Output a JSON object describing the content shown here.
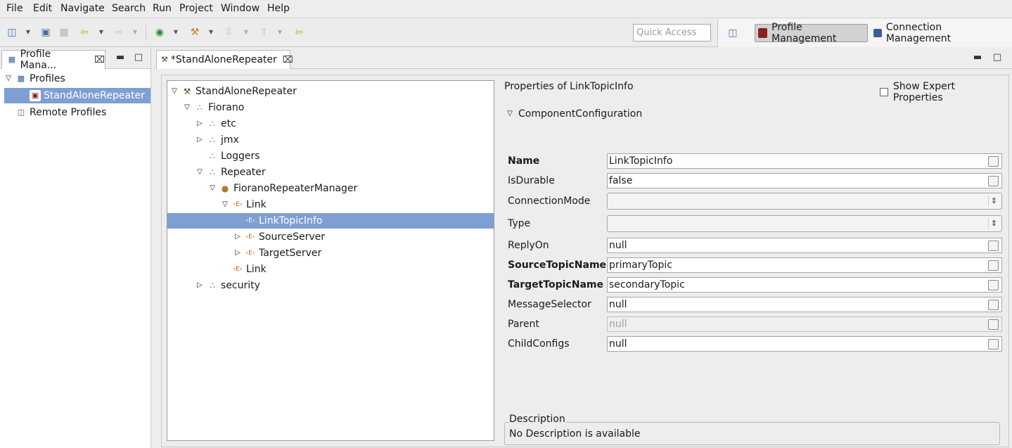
{
  "menu": [
    "File",
    "Edit",
    "Navigate",
    "Search",
    "Run",
    "Project",
    "Window",
    "Help"
  ],
  "toolbar": {
    "quick_access_placeholder": "Quick Access",
    "perspectives": [
      {
        "label": "Profile Management",
        "active": true
      },
      {
        "label": "Connection Management",
        "active": false
      }
    ]
  },
  "left_view": {
    "tab_label": "Profile Mana...",
    "tree": [
      {
        "label": "Profiles",
        "level": 0,
        "expanded": true,
        "icon": "profiles-icon"
      },
      {
        "label": "StandAloneRepeater",
        "level": 1,
        "selected": true,
        "icon": "profile-icon"
      },
      {
        "label": "Remote Profiles",
        "level": 0,
        "icon": "remote-profiles-icon"
      }
    ]
  },
  "editor": {
    "tab_label": "*StandAloneRepeater",
    "tree": [
      {
        "label": "StandAloneRepeater",
        "level": 0,
        "twisty": "open",
        "icon": "tools-icon"
      },
      {
        "label": "Fiorano",
        "level": 1,
        "twisty": "open",
        "icon": "folder-icon"
      },
      {
        "label": "etc",
        "level": 2,
        "twisty": "closed",
        "icon": "folder-icon"
      },
      {
        "label": "jmx",
        "level": 2,
        "twisty": "closed",
        "icon": "folder-icon"
      },
      {
        "label": "Loggers",
        "level": 2,
        "twisty": "none",
        "icon": "folder-icon"
      },
      {
        "label": "Repeater",
        "level": 2,
        "twisty": "open",
        "icon": "folder-icon"
      },
      {
        "label": "FioranoRepeaterManager",
        "level": 3,
        "twisty": "open",
        "icon": "bean-icon"
      },
      {
        "label": "Link",
        "level": 4,
        "twisty": "open",
        "icon": "element-icon"
      },
      {
        "label": "LinkTopicInfo",
        "level": 5,
        "twisty": "none",
        "icon": "element-icon",
        "selected": true
      },
      {
        "label": "SourceServer",
        "level": 5,
        "twisty": "closed",
        "icon": "element-icon"
      },
      {
        "label": "TargetServer",
        "level": 5,
        "twisty": "closed",
        "icon": "element-icon"
      },
      {
        "label": "Link",
        "level": 4,
        "twisty": "none",
        "icon": "element-icon"
      },
      {
        "label": "security",
        "level": 2,
        "twisty": "closed",
        "icon": "folder-icon"
      }
    ],
    "properties": {
      "title": "Properties of LinkTopicInfo",
      "show_expert_label": "Show Expert Properties",
      "section_label": "ComponentConfiguration",
      "rows": [
        {
          "label": "Name",
          "value": "LinkTopicInfo",
          "bold": true,
          "kind": "text"
        },
        {
          "label": "IsDurable",
          "value": "false",
          "bold": false,
          "kind": "text"
        },
        {
          "label": "ConnectionMode",
          "value": "",
          "bold": false,
          "kind": "combo"
        },
        {
          "label": "Type",
          "value": "",
          "bold": false,
          "kind": "combo"
        },
        {
          "label": "ReplyOn",
          "value": "null",
          "bold": false,
          "kind": "text"
        },
        {
          "label": "SourceTopicName",
          "value": "primaryTopic",
          "bold": true,
          "kind": "text"
        },
        {
          "label": "TargetTopicName",
          "value": "secondaryTopic",
          "bold": true,
          "kind": "text"
        },
        {
          "label": "MessageSelector",
          "value": "null",
          "bold": false,
          "kind": "text"
        },
        {
          "label": "Parent",
          "value": "null",
          "bold": false,
          "kind": "disabled"
        },
        {
          "label": "ChildConfigs",
          "value": "null",
          "bold": false,
          "kind": "text"
        }
      ],
      "description_label": "Description",
      "description_text": "No Description is available"
    }
  }
}
